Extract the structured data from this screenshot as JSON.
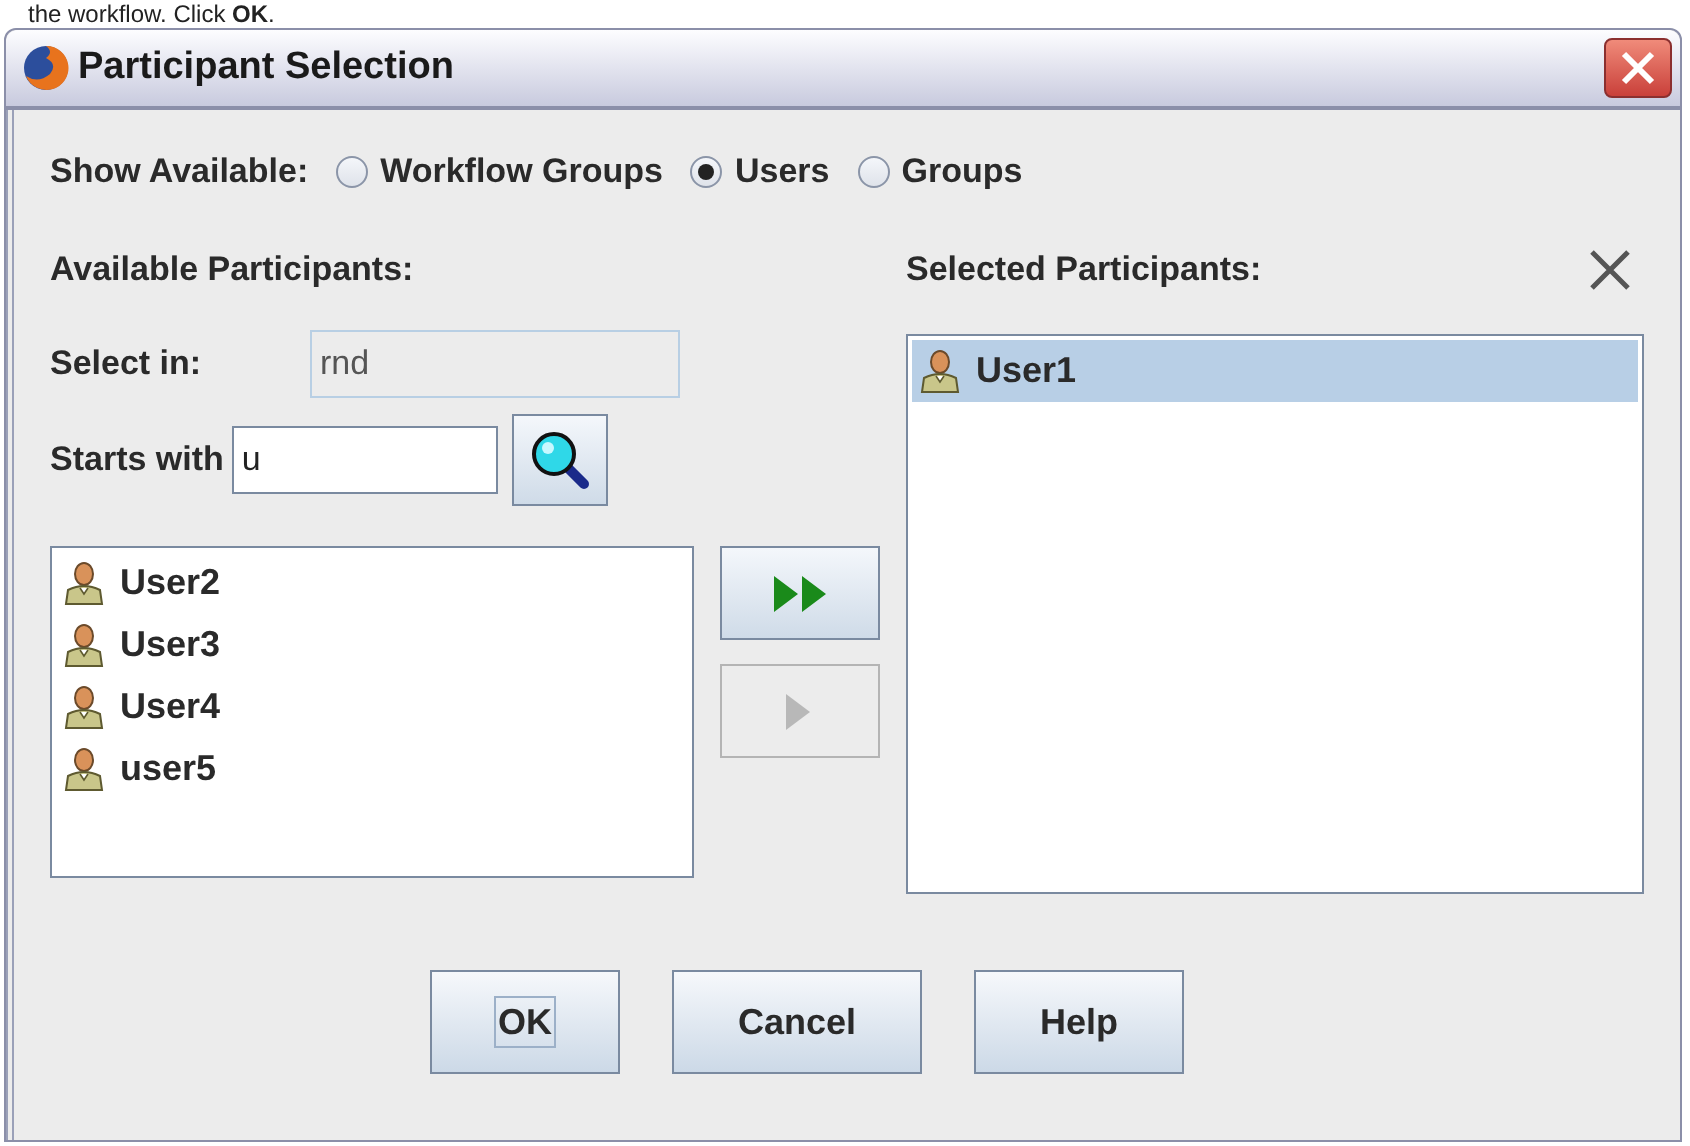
{
  "caption": "the workflow. Click **OK**.",
  "window": {
    "title": "Participant Selection"
  },
  "show_available": {
    "label": "Show Available:",
    "options": [
      {
        "label": "Workflow Groups",
        "selected": false
      },
      {
        "label": "Users",
        "selected": true
      },
      {
        "label": "Groups",
        "selected": false
      }
    ]
  },
  "available": {
    "heading": "Available Participants:",
    "select_in": {
      "label": "Select in:",
      "value": "rnd",
      "disabled": true
    },
    "starts_with": {
      "label": "Starts with",
      "value": "u",
      "disabled": false
    },
    "items": [
      {
        "label": "User2",
        "selected": false
      },
      {
        "label": "User3",
        "selected": false
      },
      {
        "label": "User4",
        "selected": false
      },
      {
        "label": "user5",
        "selected": false
      }
    ]
  },
  "move_buttons": [
    {
      "kind": "all",
      "disabled": false
    },
    {
      "kind": "one",
      "disabled": true
    }
  ],
  "selected": {
    "heading": "Selected Participants:",
    "items": [
      {
        "label": "User1",
        "selected": true
      }
    ]
  },
  "buttons": [
    {
      "label": "OK",
      "focused": true
    },
    {
      "label": "Cancel",
      "focused": false
    },
    {
      "label": "Help",
      "focused": false
    }
  ]
}
